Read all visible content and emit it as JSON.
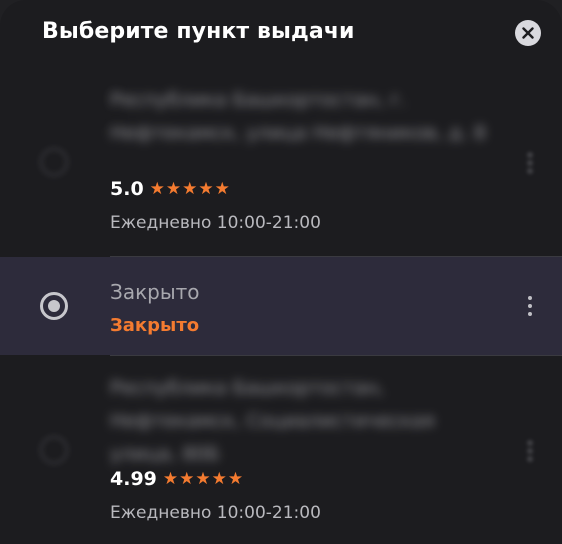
{
  "header": {
    "title": "Выберите пункт выдачи"
  },
  "pickup_points": [
    {
      "address": "Республика Башкортостан, г. Нефтекамск, улица Нефтяников, д. 8",
      "rating": "5.0",
      "stars": 5,
      "hours": "Ежедневно 10:00-21:00",
      "selected": false
    },
    {
      "name": "Закрыто",
      "status": "Закрыто",
      "selected": true
    },
    {
      "address": "Республика Башкортостан, Нефтекамск, Социалистическая улица, 80Б",
      "rating": "4.99",
      "stars": 5,
      "hours": "Ежедневно 10:00-21:00",
      "selected": false
    }
  ],
  "icons": {
    "close": "close-icon",
    "star": "star-icon",
    "menu": "more-vertical-icon"
  },
  "colors": {
    "accent": "#f47b30",
    "selected_bg": "#2d2b3b",
    "background": "#1c1c1f"
  }
}
